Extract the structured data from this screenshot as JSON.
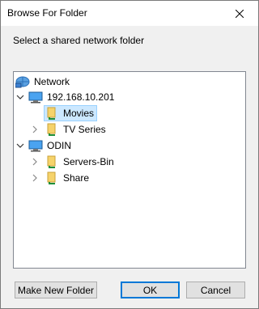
{
  "window": {
    "title": "Browse For Folder",
    "close_icon": "close-icon"
  },
  "prompt": "Select a shared network folder",
  "tree": {
    "root": {
      "label": "Network",
      "icon": "network-icon"
    },
    "hosts": [
      {
        "label": "192.168.10.201",
        "icon": "computer-icon",
        "expanded": true,
        "children": [
          {
            "label": "Movies",
            "icon": "shared-folder-icon",
            "selected": true,
            "has_children": false
          },
          {
            "label": "TV Series",
            "icon": "shared-folder-icon",
            "selected": false,
            "has_children": true
          }
        ]
      },
      {
        "label": "ODIN",
        "icon": "computer-icon",
        "expanded": true,
        "children": [
          {
            "label": "Servers-Bin",
            "icon": "shared-folder-icon",
            "selected": false,
            "has_children": true
          },
          {
            "label": "Share",
            "icon": "shared-folder-icon",
            "selected": false,
            "has_children": true
          }
        ]
      }
    ]
  },
  "buttons": {
    "new_folder": "Make New Folder",
    "ok": "OK",
    "cancel": "Cancel"
  },
  "colors": {
    "selection_bg": "#cce8ff",
    "selection_border": "#99d1ff",
    "default_button_border": "#0078d7",
    "dialog_bg": "#f0f0f0"
  }
}
